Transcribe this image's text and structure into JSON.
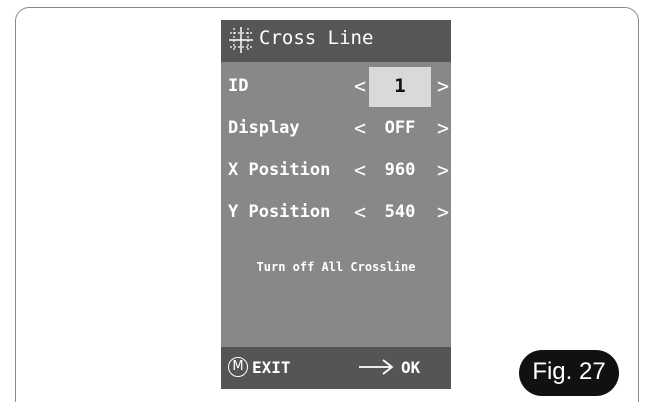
{
  "osd": {
    "title": "Cross Line",
    "title_icon": "crossline-icon",
    "rows": [
      {
        "label": "ID",
        "value": "1"
      },
      {
        "label": "Display",
        "value": "OFF"
      },
      {
        "label": "X Position",
        "value": "960"
      },
      {
        "label": "Y Position",
        "value": "540"
      }
    ],
    "arrow_left": "<",
    "arrow_right": ">",
    "turn_off_label": "Turn off All Crossline",
    "footer": {
      "m_label": "M",
      "exit_label": "EXIT",
      "ok_label": "OK",
      "ok_icon": "arrow-right-icon"
    }
  },
  "figure": {
    "label": "Fig. 27"
  },
  "colors": {
    "osd_background": "#888888",
    "title_bar": "#565656",
    "selected_value": "#d9d9d9",
    "figure_badge": "#111111"
  }
}
